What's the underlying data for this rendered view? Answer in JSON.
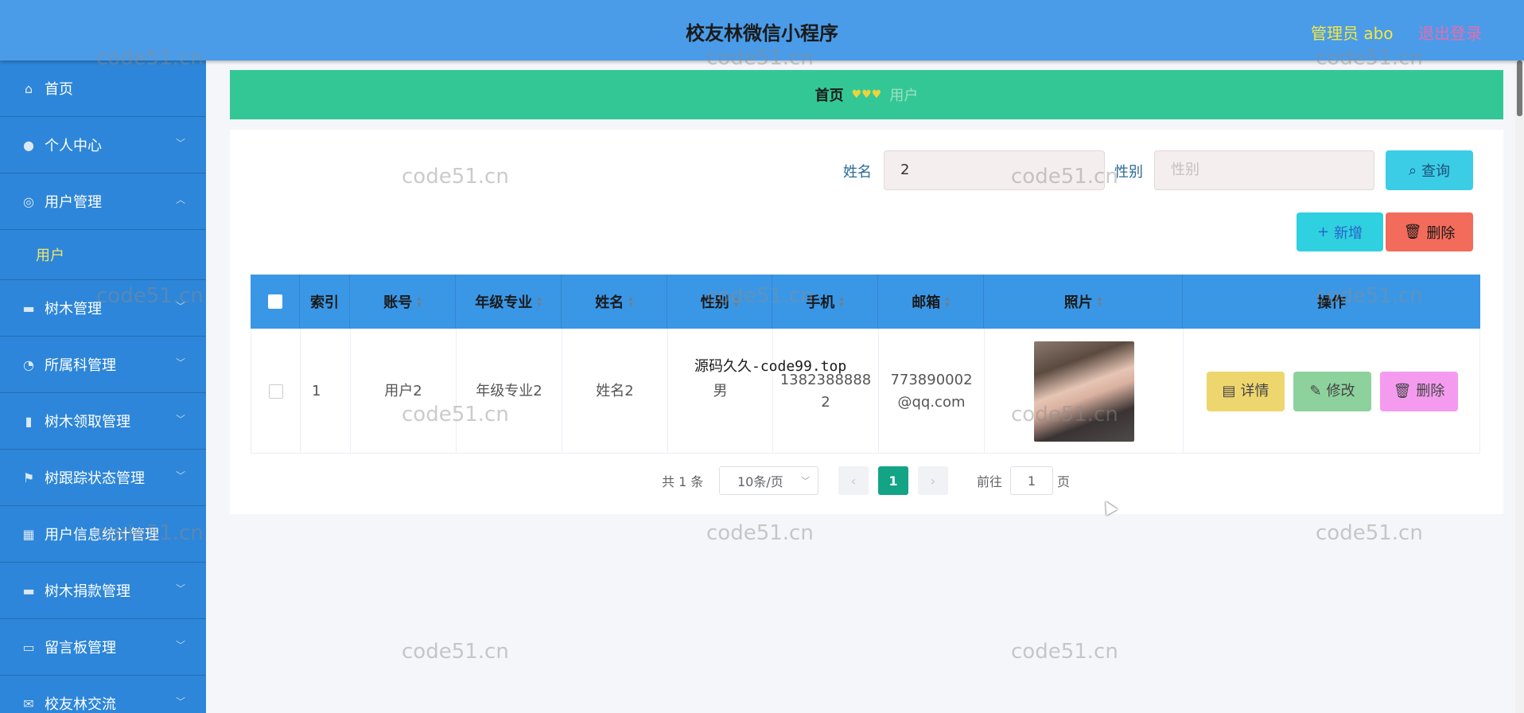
{
  "header": {
    "title": "校友林微信小程序",
    "user": "管理员 abo",
    "logout": "退出登录"
  },
  "sidebar": {
    "items": [
      {
        "label": "首页",
        "icon": "home-icon"
      },
      {
        "label": "个人中心",
        "icon": "user-icon"
      },
      {
        "label": "用户管理",
        "icon": "users-icon",
        "expanded": true,
        "children": [
          "用户"
        ]
      },
      {
        "label": "树木管理",
        "icon": "monitor-icon"
      },
      {
        "label": "所属科管理",
        "icon": "compass-icon"
      },
      {
        "label": "树木领取管理",
        "icon": "chart-icon"
      },
      {
        "label": "树跟踪状态管理",
        "icon": "flag-icon"
      },
      {
        "label": "用户信息统计管理",
        "icon": "grid-icon"
      },
      {
        "label": "树木捐款管理",
        "icon": "monitor-icon"
      },
      {
        "label": "留言板管理",
        "icon": "message-icon"
      },
      {
        "label": "校友林交流",
        "icon": "mail-icon"
      }
    ]
  },
  "breadcrumb": {
    "home": "首页",
    "hearts": "♥♥♥",
    "current": "用户"
  },
  "search": {
    "name_label": "姓名",
    "name_value": "2",
    "gender_label": "性别",
    "gender_placeholder": "性别",
    "query_button": "查询"
  },
  "actions": {
    "add": "新增",
    "delete": "删除"
  },
  "table": {
    "columns": [
      "索引",
      "账号",
      "年级专业",
      "姓名",
      "性别",
      "手机",
      "邮箱",
      "照片",
      "操作"
    ],
    "rows": [
      {
        "index": "1",
        "account": "用户2",
        "major": "年级专业2",
        "name": "姓名2",
        "gender": "男",
        "phone_line1": "1382388888",
        "phone_line2": "2",
        "email_line1": "773890002",
        "email_line2": "@qq.com",
        "detail": "详情",
        "edit": "修改",
        "delete": "删除"
      }
    ]
  },
  "pagination": {
    "total": "共 1 条",
    "page_size": "10条/页",
    "current": "1",
    "goto_prefix": "前往",
    "goto_value": "1",
    "goto_suffix": "页"
  },
  "watermark": {
    "text": "code51.cn",
    "overlay": "源码久久-code99.top"
  },
  "colors": {
    "header": "#4a9ce8",
    "sidebar": "#2d86d9",
    "breadcrumb": "#33c795",
    "table_head": "#3a97e6"
  }
}
